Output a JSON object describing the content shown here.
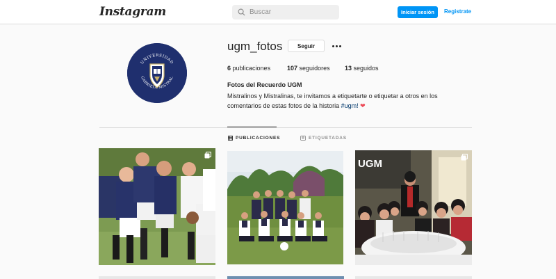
{
  "nav": {
    "logo": "Instagram",
    "search_placeholder": "Buscar",
    "login_label": "Iniciar sesión",
    "register_label": "Registrate",
    "accent_color": "#0095f6"
  },
  "profile": {
    "username": "ugm_fotos",
    "follow_label": "Seguir",
    "stats": {
      "posts_count": "6",
      "posts_label": "publicaciones",
      "followers_count": "107",
      "followers_label": "seguidores",
      "following_count": "13",
      "following_label": "seguidos"
    },
    "bio_name": "Fotos del Recuerdo UGM",
    "bio_text": "Mistralinos y Mistralinas, te invitamos a etiquetarte o etiquetar a otros en los comentarios de estas fotos de la historia",
    "bio_hashtag": "#ugm!",
    "avatar_text_top": "UNIVERSIDAD",
    "avatar_text_bottom": "GABRIELA MISTRAL"
  },
  "tabs": [
    {
      "label": "PUBLICACIONES",
      "active": true,
      "icon": "grid-icon"
    },
    {
      "label": "ETIQUETADAS",
      "active": false,
      "icon": "tag-icon"
    }
  ],
  "posts": [
    {
      "subject": "rugby-team-photo",
      "multi": true
    },
    {
      "subject": "soccer-team-photo",
      "multi": false
    },
    {
      "subject": "gala-dinner-photo",
      "multi": true,
      "banner_text": "UGM"
    }
  ]
}
